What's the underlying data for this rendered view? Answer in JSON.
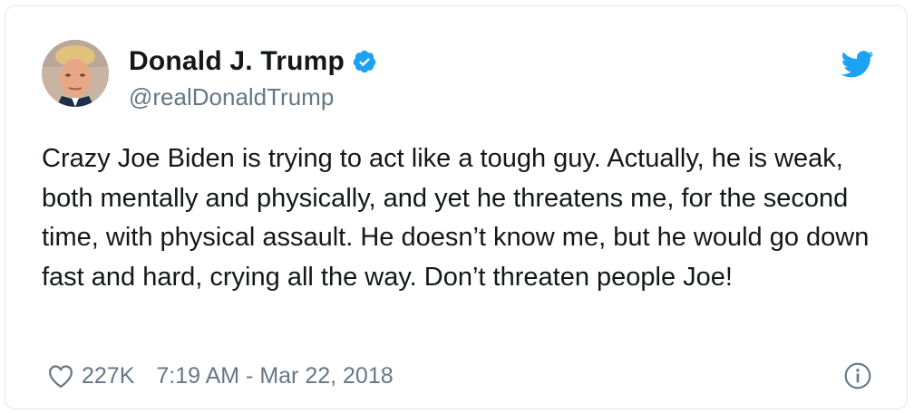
{
  "tweet": {
    "display_name": "Donald J. Trump",
    "handle": "@realDonaldTrump",
    "verified": true,
    "text": "Crazy Joe Biden is trying to act like a tough guy. Actually, he is weak, both mentally and physically, and yet he threatens me, for the second time, with physical assault. He doesn’t know me, but he would go down fast and hard, crying all the way. Don’t threaten people Joe!",
    "likes": "227K",
    "timestamp": "7:19 AM - Mar 22, 2018"
  },
  "icons": {
    "avatar": "profile-photo",
    "verified": "verified-badge-icon",
    "brand": "twitter-bird-icon",
    "like": "heart-icon",
    "info": "info-icon"
  },
  "colors": {
    "brand_blue": "#1da1f2",
    "text_primary": "#14171a",
    "text_secondary": "#657786",
    "border": "#e1e8ed"
  }
}
